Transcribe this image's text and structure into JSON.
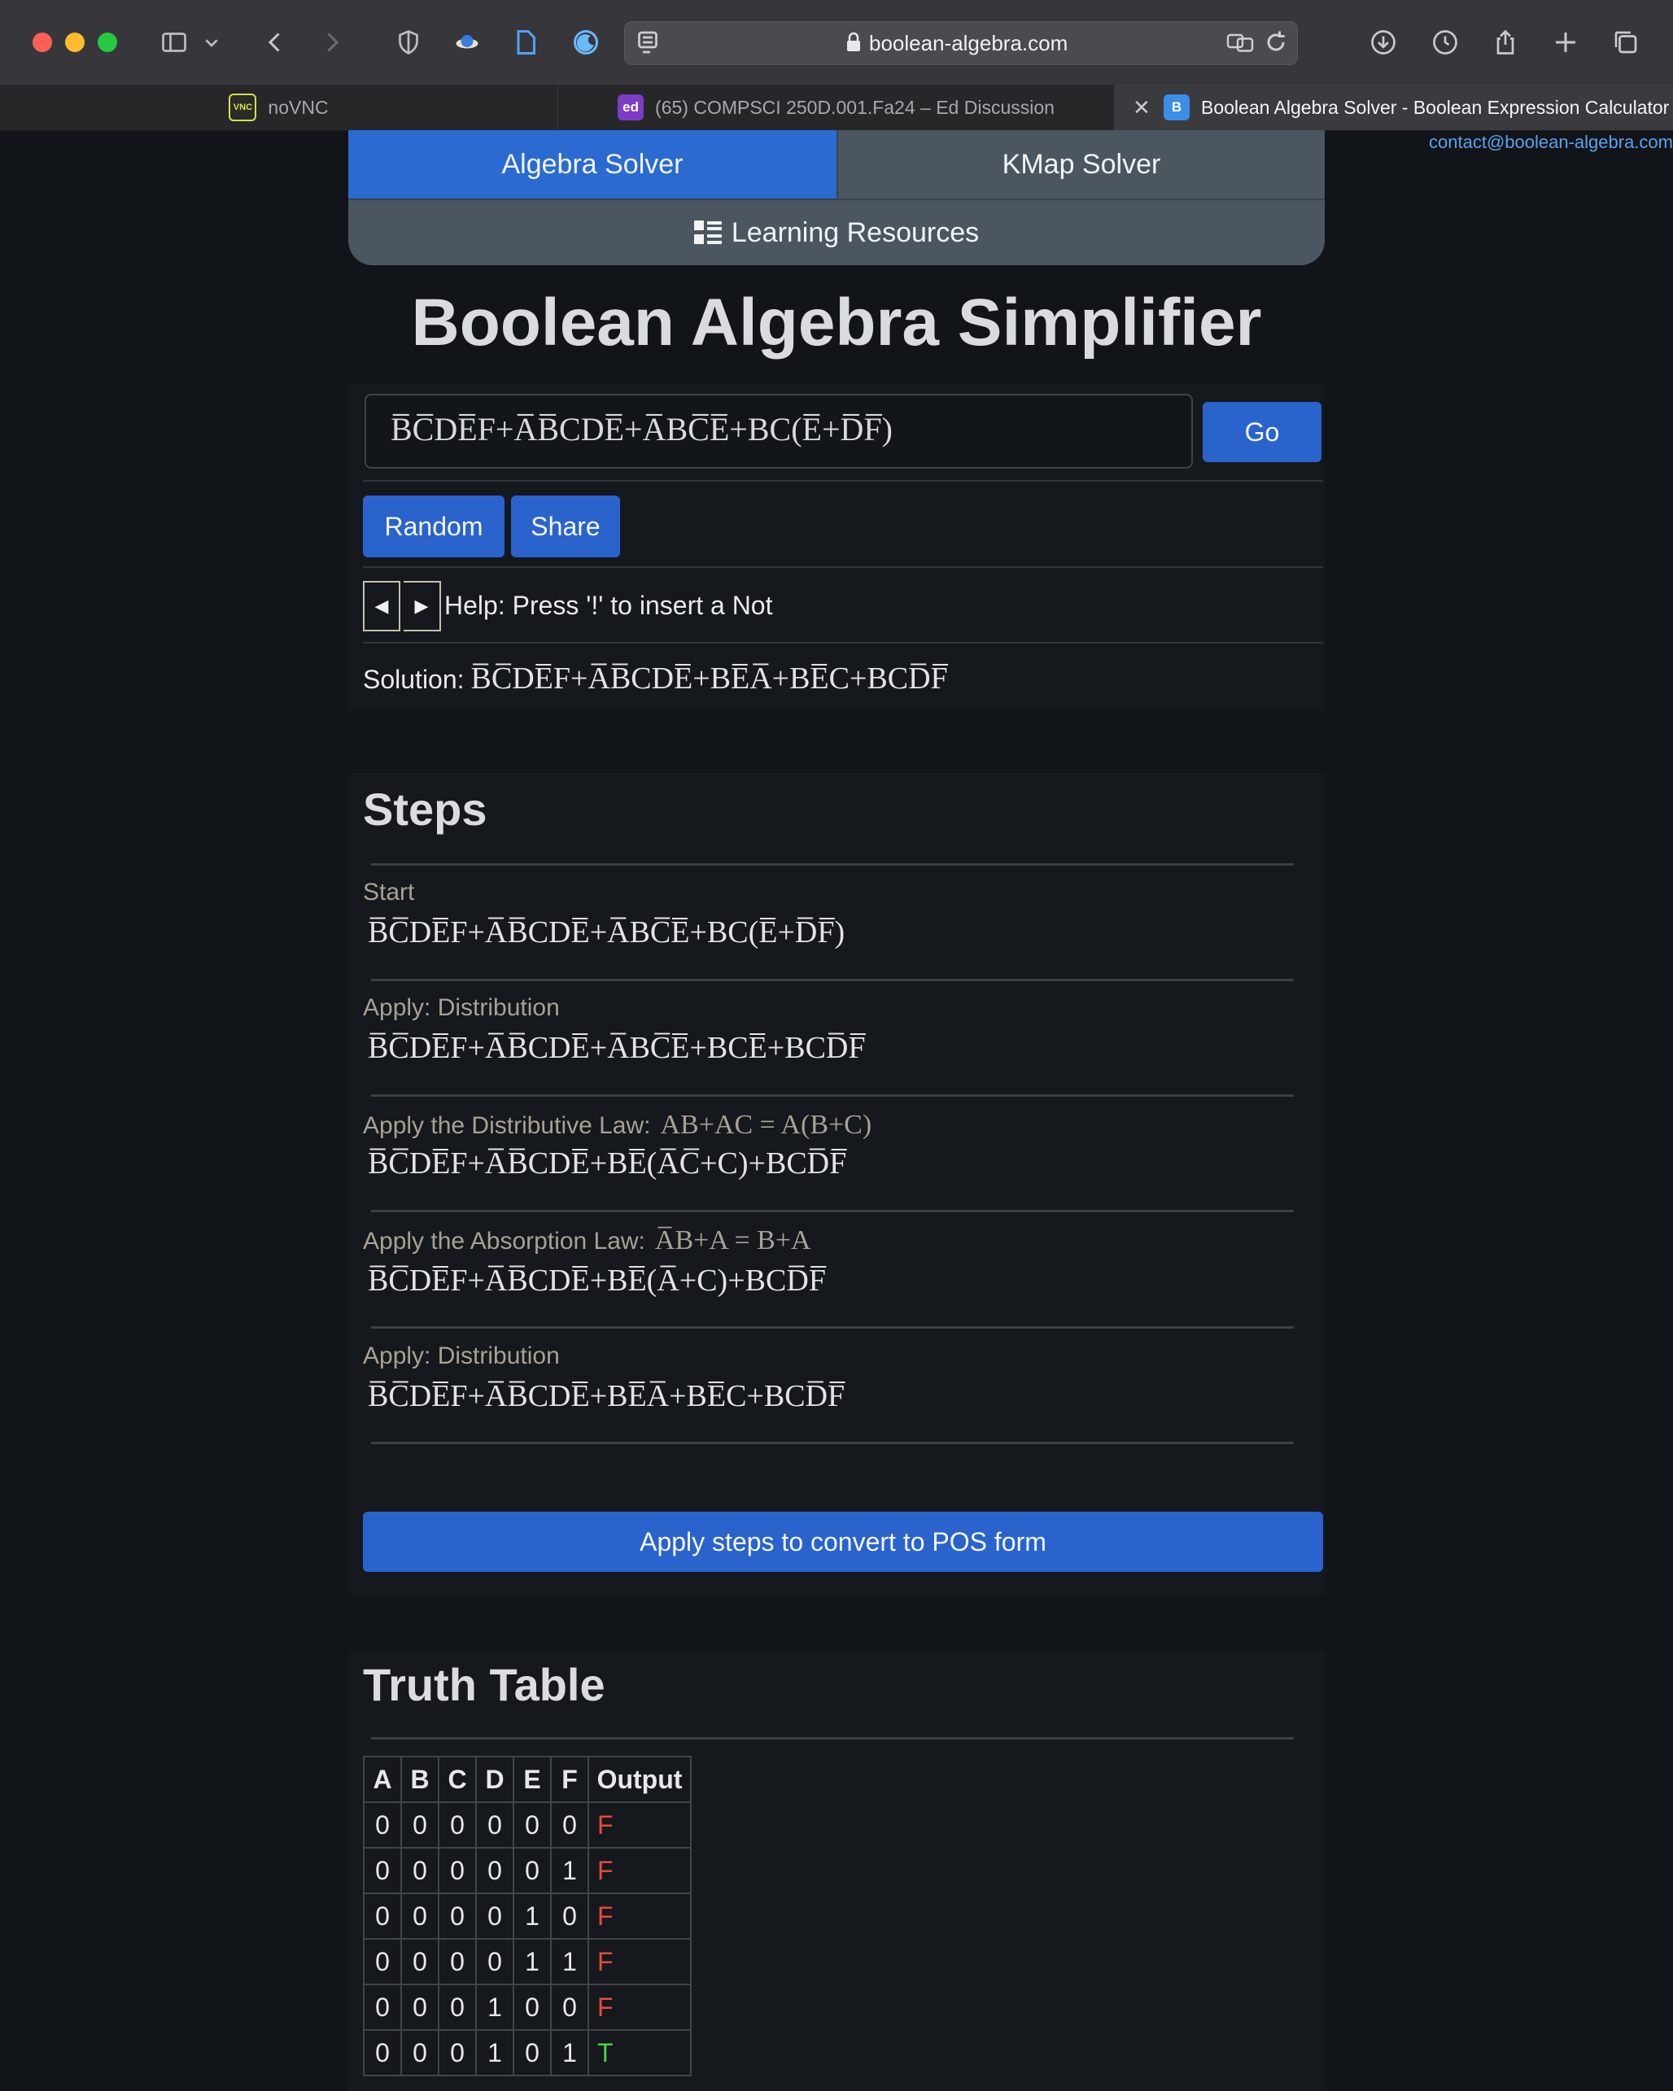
{
  "browser": {
    "url": "boolean-algebra.com",
    "tabs": [
      {
        "label": "noVNC",
        "favicon": "VNC"
      },
      {
        "label": "(65) COMPSCI 250D.001.Fa24 – Ed Discussion",
        "favicon": "ed"
      },
      {
        "label": "Boolean Algebra Solver - Boolean Expression Calculator",
        "favicon": "B"
      }
    ]
  },
  "contact": "contact@boolean-algebra.com",
  "nav": {
    "algebra_solver": "Algebra Solver",
    "kmap_solver": "KMap Solver",
    "learning_resources": "Learning Resources"
  },
  "title": "Boolean Algebra Simplifier",
  "input_expression": "B̅C̅DE̅F+A̅B̅CDE̅+A̅BC̅E̅+BC(E̅+D̅F̅)",
  "buttons": {
    "go": "Go",
    "random": "Random",
    "share": "Share"
  },
  "help": "Help: Press '!' to insert a Not",
  "solution_label": "Solution:",
  "solution_expression": "B̅C̅DE̅F+A̅B̅CDE̅+BE̅A̅+BE̅C+BCD̅F̅",
  "steps_heading": "Steps",
  "steps": [
    {
      "label": "Start",
      "law": "",
      "expression": "B̅C̅DE̅F+A̅B̅CDE̅+A̅BC̅E̅+BC(E̅+D̅F̅)"
    },
    {
      "label": "Apply: Distribution",
      "law": "",
      "expression": "B̅C̅DE̅F+A̅B̅CDE̅+A̅BC̅E̅+BCE̅+BCD̅F̅"
    },
    {
      "label": "Apply the Distributive Law:",
      "law": "AB+AC = A(B+C)",
      "expression": "B̅C̅DE̅F+A̅B̅CDE̅+BE̅(A̅C̅+C)+BCD̅F̅"
    },
    {
      "label": "Apply the Absorption Law:",
      "law": "A̅B+A = B+A",
      "expression": "B̅C̅DE̅F+A̅B̅CDE̅+BE̅(A̅+C)+BCD̅F̅"
    },
    {
      "label": "Apply: Distribution",
      "law": "",
      "expression": "B̅C̅DE̅F+A̅B̅CDE̅+BE̅A̅+BE̅C+BCD̅F̅"
    }
  ],
  "pos_button": "Apply steps to convert to POS form",
  "truth_table_heading": "Truth Table",
  "truth_table": {
    "headers": [
      "A",
      "B",
      "C",
      "D",
      "E",
      "F",
      "Output"
    ],
    "rows": [
      [
        "0",
        "0",
        "0",
        "0",
        "0",
        "0",
        "F"
      ],
      [
        "0",
        "0",
        "0",
        "0",
        "0",
        "1",
        "F"
      ],
      [
        "0",
        "0",
        "0",
        "0",
        "1",
        "0",
        "F"
      ],
      [
        "0",
        "0",
        "0",
        "0",
        "1",
        "1",
        "F"
      ],
      [
        "0",
        "0",
        "0",
        "1",
        "0",
        "0",
        "F"
      ],
      [
        "0",
        "0",
        "0",
        "1",
        "0",
        "1",
        "T"
      ]
    ]
  }
}
